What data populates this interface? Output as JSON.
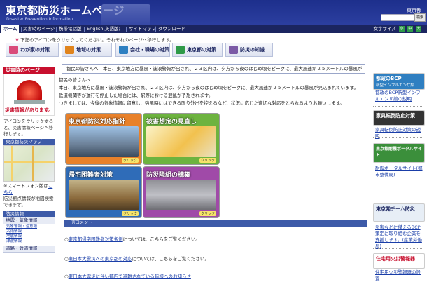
{
  "header": {
    "title": "東京都防災ホームページ",
    "subtitle": "Disaster Prevention Information",
    "org_logo": "東京都",
    "search_button": "検索"
  },
  "nav": {
    "items": [
      "ホーム",
      "災害時のページ",
      "携帯電話版",
      "English(英語版)",
      "サイトマップ",
      "ダウンロード"
    ],
    "font_size_label": "文字サイズ",
    "font_size_options": [
      "小",
      "中",
      "大"
    ]
  },
  "intro": "下記のアイコンをクリックしてください。それぞれのページへ移行します。",
  "tabs": [
    {
      "label": "わが家の対策",
      "icon": "house-icon",
      "color": "#d94b7a"
    },
    {
      "label": "地域の対策",
      "icon": "community-icon",
      "color": "#e0841d"
    },
    {
      "label": "会社・職場の対策",
      "icon": "office-icon",
      "color": "#2d7fc1"
    },
    {
      "label": "東京都の対策",
      "icon": "government-icon",
      "color": "#2e9a48"
    },
    {
      "label": "防災の知識",
      "icon": "book-icon",
      "color": "#7b5aa6"
    }
  ],
  "left": {
    "header": "災害時のページ",
    "alarm_label": "災害情報があります。",
    "alarm_text": "アイコンをクリックすると、災害情報ページへ移行します。",
    "map_header": "東京都防災マップ",
    "map_note_1": "※スマートフォン版は",
    "map_note_link": "こちら",
    "map_note_2": "防災拠点情報が地図検索できます。",
    "menu_header": "防災情報",
    "menu_sub1": "地震・気象情報",
    "menu_links": [
      "気象警報・注意報",
      "大雨情報",
      "地震情報",
      "津波情報"
    ],
    "menu_sub2": "道路・鉄道情報"
  },
  "main": {
    "ticker": "都民の皆さんへ　本日、東京地方に暴風・波浪警報が出され、２３区内は、夕方から夜のはじめ頃をピークに、最大風速が２５メートルの暴風が",
    "message": [
      "都民の皆さんへ",
      "本日、東京地方に暴風・波浪警報が出され、２３区内は、夕方から夜のはじめ頃をピークに、最大風速が２５メートルの暴風が見込まれています。",
      "鉄道機関等が運行を停止した場合には、駅等における混乱が予想されます。",
      "つきましては、今後の気象情報に留意し、強風時にはできる限り外出を控えるなど、状況に応じた適切な対応をとられるようお願いします。"
    ],
    "tiles": [
      {
        "title": "東京都防災対応指針",
        "bg": "#e8812a",
        "click": "クリック"
      },
      {
        "title": "被害想定の見直し",
        "bg": "#6db33f",
        "click": "クリック"
      },
      {
        "title": "帰宅困難者対策",
        "bg": "#2f6cb8",
        "click": "クリック"
      },
      {
        "title": "防災隣組の構築",
        "bg": "#a04aa8",
        "click": "クリック"
      }
    ],
    "comment_header": "一言コメント",
    "comments": [
      {
        "link": "東京都帰宅困難者対策条例",
        "text": "については、こちらをご覧ください。"
      },
      {
        "link": "東日本大震災への東京都の対応",
        "text": "については、こちらをご覧ください。"
      },
      {
        "link": "東日本大震災に伴い都内で避難されている皆様へのお知らせ",
        "text": ""
      }
    ]
  },
  "right": {
    "banners": [
      {
        "title": "都政のBCP",
        "sub": "新型インフルエンザ編",
        "bg": "#2f7fc1",
        "link": "都政のBCP新型インフルエンザ編の説明"
      },
      {
        "title": "家具転倒防止対策",
        "sub": "",
        "bg": "#333333",
        "link": "家具転倒防止対策の説明"
      },
      {
        "title": "東京都耐震ポータルサイト",
        "sub": "",
        "bg": "#3b8f3b",
        "link": "耐震ポータルサイト(都市整備局)"
      },
      {
        "title": "東京発チーム防災",
        "sub": "",
        "bg": "#e7eef6",
        "link": "災害などに備えるBCP策定に取り組む企業を支援します。(産業労働局)"
      },
      {
        "title": "住宅用火災警報器",
        "sub": "",
        "bg": "#ffffff",
        "link": "住宅用火災警報器の設置"
      }
    ]
  }
}
